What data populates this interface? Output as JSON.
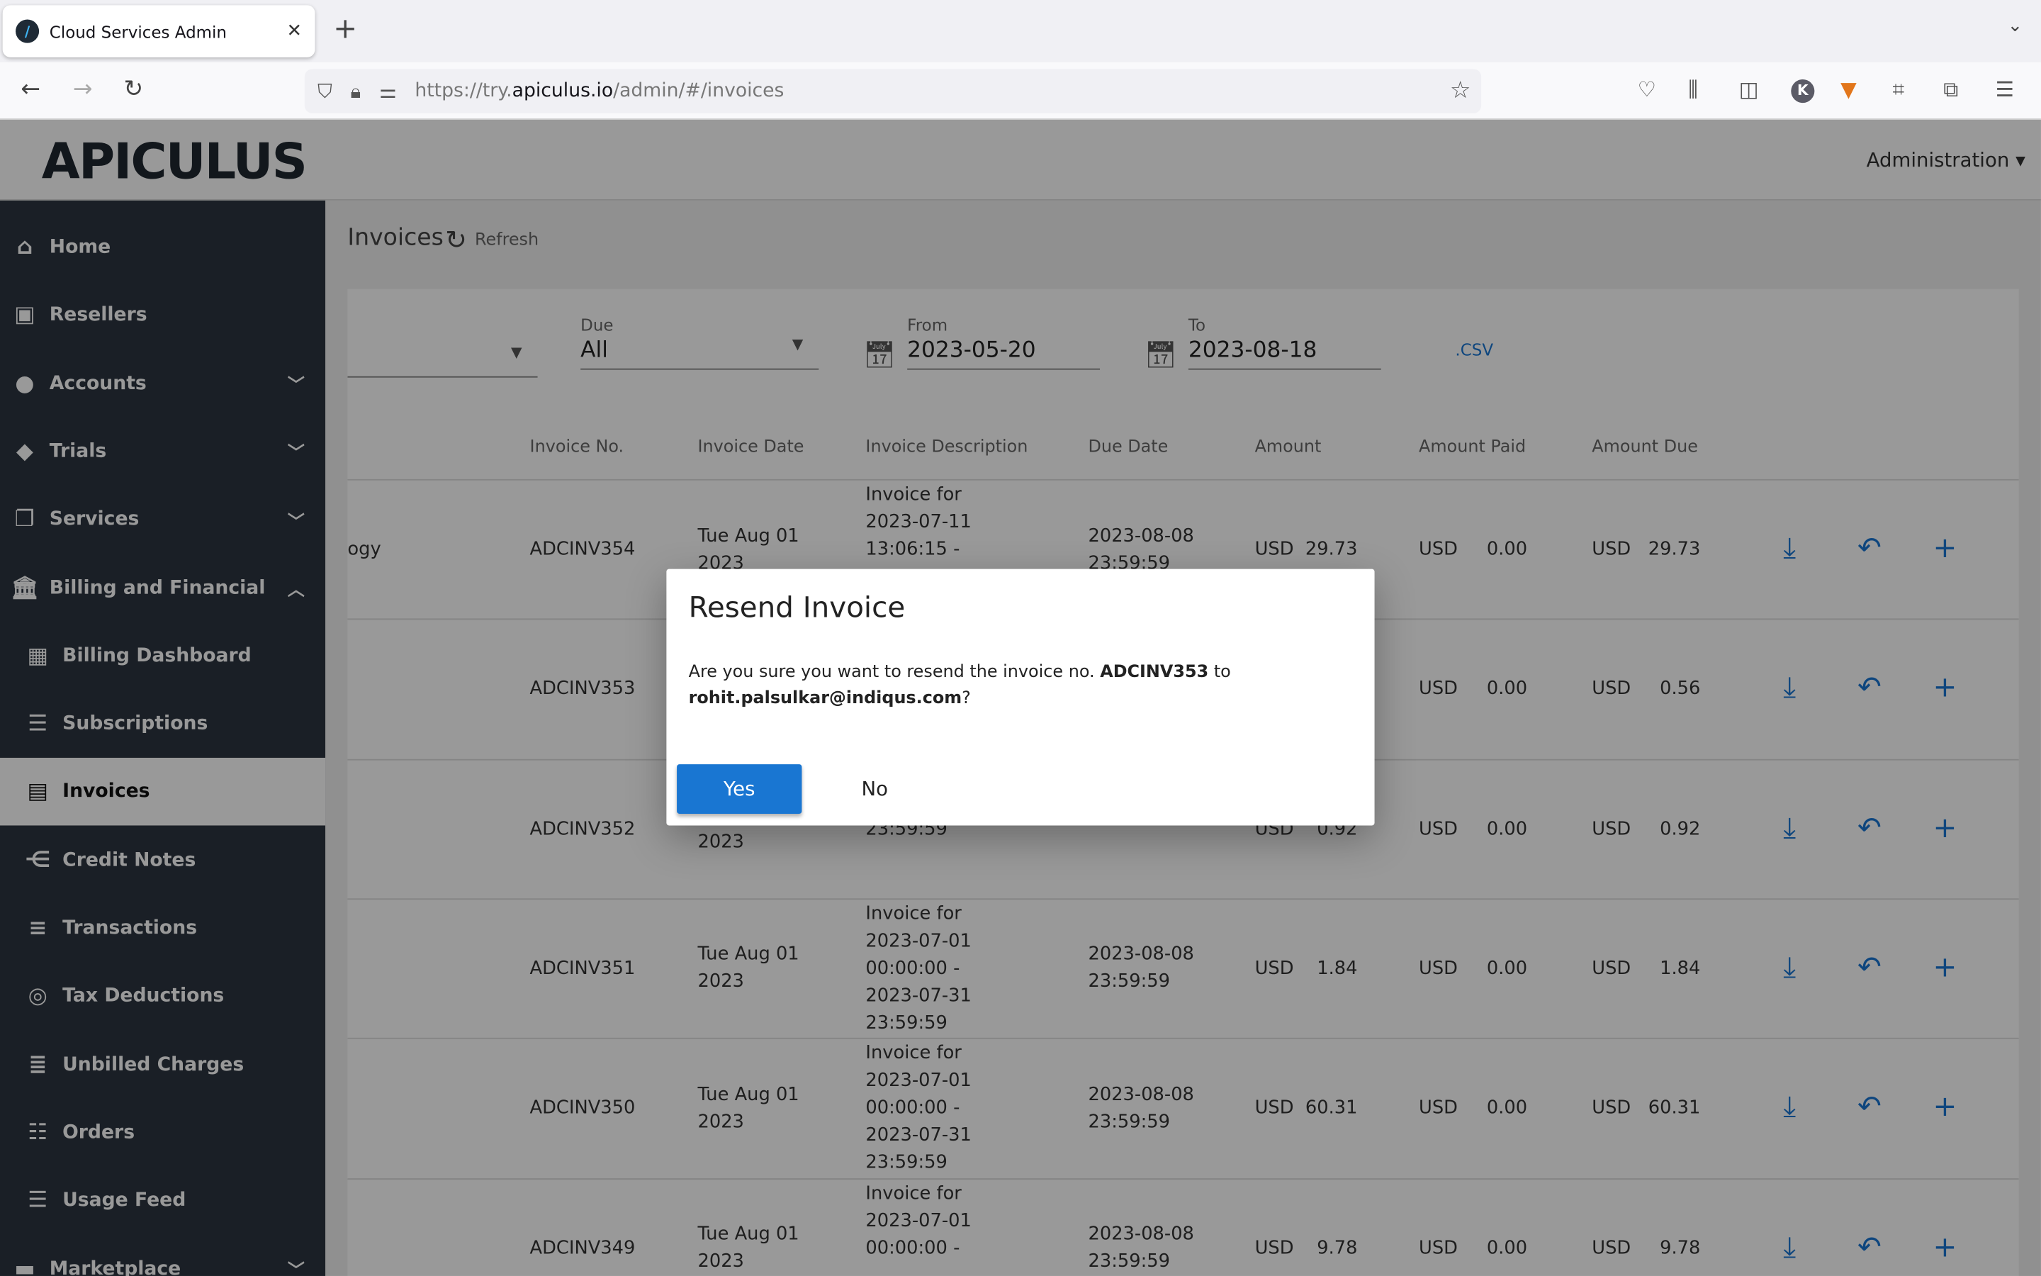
{
  "browser": {
    "tab_title": "Cloud Services Admin",
    "url_prefix": "https://try.",
    "url_domain": "apiculus.io",
    "url_path": "/admin/#/invoices"
  },
  "app": {
    "logo": "APICULUS",
    "user_menu": "Administration"
  },
  "sidebar": {
    "items": [
      {
        "label": "Home",
        "icon": "home-icon",
        "glyph": "⌂"
      },
      {
        "label": "Resellers",
        "icon": "contact-icon",
        "glyph": "▣"
      },
      {
        "label": "Accounts",
        "icon": "account-icon",
        "glyph": "●",
        "chevron": "down"
      },
      {
        "label": "Trials",
        "icon": "tag-icon",
        "glyph": "◆",
        "chevron": "down"
      },
      {
        "label": "Services",
        "icon": "library-icon",
        "glyph": "❐",
        "chevron": "down"
      },
      {
        "label": "Billing and Financial",
        "icon": "bank-icon",
        "glyph": "🏛",
        "chevron": "up"
      },
      {
        "label": "Billing Dashboard",
        "icon": "dashboard-icon",
        "glyph": "▦",
        "sub": true
      },
      {
        "label": "Subscriptions",
        "icon": "list-icon",
        "glyph": "☰",
        "sub": true
      },
      {
        "label": "Invoices",
        "icon": "receipt-icon",
        "glyph": "▤",
        "sub": true,
        "active": true
      },
      {
        "label": "Credit Notes",
        "icon": "credit-note-icon",
        "glyph": "⋲",
        "sub": true
      },
      {
        "label": "Transactions",
        "icon": "list-icon",
        "glyph": "≡",
        "sub": true
      },
      {
        "label": "Tax Deductions",
        "icon": "tax-icon",
        "glyph": "◎",
        "sub": true
      },
      {
        "label": "Unbilled Charges",
        "icon": "notes-icon",
        "glyph": "≣",
        "sub": true
      },
      {
        "label": "Orders",
        "icon": "orders-icon",
        "glyph": "☷",
        "sub": true
      },
      {
        "label": "Usage Feed",
        "icon": "feed-icon",
        "glyph": "☰",
        "sub": true
      },
      {
        "label": "Marketplace",
        "icon": "marketplace-icon",
        "glyph": "▬",
        "chevron": "down"
      }
    ]
  },
  "page": {
    "title": "Invoices",
    "refresh_label": "Refresh"
  },
  "filters": {
    "due_label": "Due",
    "due_value": "All",
    "from_label": "From",
    "from_value": "2023-05-20",
    "to_label": "To",
    "to_value": "2023-08-18",
    "csv_label": ".CSV"
  },
  "table": {
    "headers": [
      "Invoice No.",
      "Invoice Date",
      "Invoice Description",
      "Due Date",
      "Amount",
      "Amount Paid",
      "Amount Due"
    ],
    "rows": [
      {
        "customer": "ogy",
        "no": "ADCINV354",
        "date": "Tue Aug 01 2023",
        "desc": "Invoice for 2023-07-11 13:06:15 -",
        "due": "2023-08-08 23:59:59",
        "amount": "USD  29.73",
        "paid": "USD     0.00",
        "amount_due": "USD   29.73"
      },
      {
        "customer": "",
        "no": "ADCINV353",
        "date": "",
        "desc": "",
        "due": "",
        "amount": "",
        "paid": "USD     0.00",
        "amount_due": "USD     0.56"
      },
      {
        "customer": "",
        "no": "ADCINV352",
        "date": "Tue Aug 01 2023",
        "desc": "12:56:45 - 2023-07-31 23:59:59",
        "due": "23:59:59",
        "amount": "USD    0.92",
        "paid": "USD     0.00",
        "amount_due": "USD     0.92"
      },
      {
        "customer": "",
        "no": "ADCINV351",
        "date": "Tue Aug 01 2023",
        "desc": "Invoice for 2023-07-01 00:00:00 - 2023-07-31 23:59:59",
        "due": "2023-08-08 23:59:59",
        "amount": "USD    1.84",
        "paid": "USD     0.00",
        "amount_due": "USD     1.84"
      },
      {
        "customer": "",
        "no": "ADCINV350",
        "date": "Tue Aug 01 2023",
        "desc": "Invoice for 2023-07-01 00:00:00 - 2023-07-31 23:59:59",
        "due": "2023-08-08 23:59:59",
        "amount": "USD  60.31",
        "paid": "USD     0.00",
        "amount_due": "USD   60.31"
      },
      {
        "customer": "",
        "no": "ADCINV349",
        "date": "Tue Aug 01 2023",
        "desc": "Invoice for 2023-07-01 00:00:00 -",
        "due": "2023-08-08 23:59:59",
        "amount": "USD    9.78",
        "paid": "USD     0.00",
        "amount_due": "USD     9.78"
      }
    ]
  },
  "modal": {
    "title": "Resend Invoice",
    "text_before": "Are you sure you want to resend the invoice no. ",
    "invoice_no": "ADCINV353",
    "text_mid": " to ",
    "email": "rohit.palsulkar@indiqus.com",
    "text_after": "?",
    "yes_label": "Yes",
    "no_label": "No"
  },
  "colors": {
    "accent": "#1976d2",
    "sidebar": "#2c3540"
  }
}
